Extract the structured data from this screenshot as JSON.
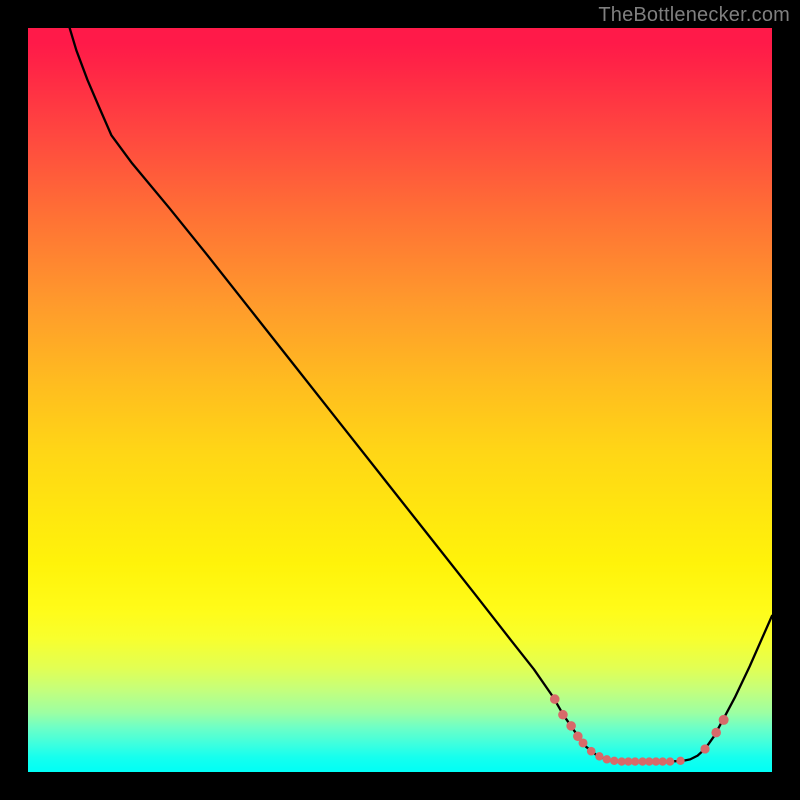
{
  "attribution": "TheBottlenecker.com",
  "colors": {
    "background": "#000000",
    "curve": "#000000",
    "dot": "#d76a6a"
  },
  "chart_data": {
    "type": "line",
    "title": "",
    "xlabel": "",
    "ylabel": "",
    "xlim": [
      0,
      100
    ],
    "ylim": [
      0,
      100
    ],
    "note": "No axis ticks or numeric labels are rendered in the image; x and y are in 0–100 SVG-percent coordinates (y = 0 is top, y = 100 is bottom).",
    "curve_points": [
      {
        "x": 5.6,
        "y": 0.0
      },
      {
        "x": 6.5,
        "y": 3.0
      },
      {
        "x": 8.0,
        "y": 7.0
      },
      {
        "x": 9.5,
        "y": 10.5
      },
      {
        "x": 11.2,
        "y": 14.4
      },
      {
        "x": 14.0,
        "y": 18.2
      },
      {
        "x": 19.0,
        "y": 24.2
      },
      {
        "x": 24.0,
        "y": 30.4
      },
      {
        "x": 30.0,
        "y": 38.0
      },
      {
        "x": 36.0,
        "y": 45.6
      },
      {
        "x": 42.0,
        "y": 53.2
      },
      {
        "x": 48.0,
        "y": 60.8
      },
      {
        "x": 54.0,
        "y": 68.4
      },
      {
        "x": 60.0,
        "y": 76.0
      },
      {
        "x": 65.0,
        "y": 82.4
      },
      {
        "x": 68.0,
        "y": 86.2
      },
      {
        "x": 70.5,
        "y": 89.8
      },
      {
        "x": 72.0,
        "y": 92.4
      },
      {
        "x": 73.8,
        "y": 95.0
      },
      {
        "x": 75.0,
        "y": 96.6
      },
      {
        "x": 76.5,
        "y": 97.8
      },
      {
        "x": 78.0,
        "y": 98.4
      },
      {
        "x": 80.0,
        "y": 98.6
      },
      {
        "x": 82.0,
        "y": 98.6
      },
      {
        "x": 84.0,
        "y": 98.6
      },
      {
        "x": 86.0,
        "y": 98.6
      },
      {
        "x": 88.0,
        "y": 98.5
      },
      {
        "x": 89.0,
        "y": 98.3
      },
      {
        "x": 90.0,
        "y": 97.8
      },
      {
        "x": 91.0,
        "y": 96.9
      },
      {
        "x": 92.2,
        "y": 95.2
      },
      {
        "x": 93.4,
        "y": 93.0
      },
      {
        "x": 95.0,
        "y": 90.0
      },
      {
        "x": 97.0,
        "y": 85.8
      },
      {
        "x": 100.0,
        "y": 79.0
      }
    ],
    "dot_points": [
      {
        "x": 70.8,
        "y": 90.2,
        "r": 4.8
      },
      {
        "x": 71.9,
        "y": 92.3,
        "r": 4.8
      },
      {
        "x": 73.0,
        "y": 93.8,
        "r": 4.8
      },
      {
        "x": 73.9,
        "y": 95.2,
        "r": 4.8
      },
      {
        "x": 74.6,
        "y": 96.1,
        "r": 4.5
      },
      {
        "x": 75.7,
        "y": 97.2,
        "r": 4.3
      },
      {
        "x": 76.8,
        "y": 97.9,
        "r": 4.2
      },
      {
        "x": 77.8,
        "y": 98.3,
        "r": 4.2
      },
      {
        "x": 78.8,
        "y": 98.5,
        "r": 4.2
      },
      {
        "x": 79.8,
        "y": 98.6,
        "r": 4.2
      },
      {
        "x": 80.7,
        "y": 98.6,
        "r": 4.2
      },
      {
        "x": 81.6,
        "y": 98.6,
        "r": 4.2
      },
      {
        "x": 82.6,
        "y": 98.6,
        "r": 4.2
      },
      {
        "x": 83.5,
        "y": 98.6,
        "r": 4.2
      },
      {
        "x": 84.4,
        "y": 98.6,
        "r": 4.2
      },
      {
        "x": 85.3,
        "y": 98.6,
        "r": 4.2
      },
      {
        "x": 86.3,
        "y": 98.6,
        "r": 4.2
      },
      {
        "x": 87.7,
        "y": 98.5,
        "r": 4.2
      },
      {
        "x": 91.0,
        "y": 96.9,
        "r": 4.6
      },
      {
        "x": 92.5,
        "y": 94.7,
        "r": 4.8
      },
      {
        "x": 93.5,
        "y": 93.0,
        "r": 5.0
      }
    ]
  }
}
